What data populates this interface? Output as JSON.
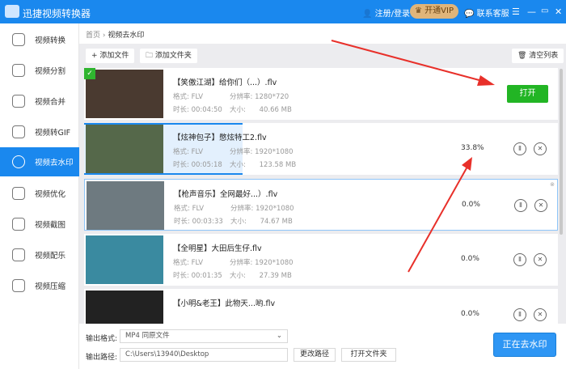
{
  "app": {
    "title": "迅捷视频转换器",
    "login": "注册/登录",
    "vip": "开通VIP",
    "support": "联系客服"
  },
  "sidebar": {
    "items": [
      "视频转换",
      "视频分割",
      "视频合并",
      "视频转GIF",
      "视频去水印",
      "视频优化",
      "视频截图",
      "视频配乐",
      "视频压缩"
    ],
    "active": 4
  },
  "breadcrumb": {
    "home": "首页",
    "sep": "›",
    "current": "视频去水印"
  },
  "toolbar": {
    "add_file": "+ 添加文件",
    "add_folder": "添加文件夹",
    "clear": "清空列表"
  },
  "labels": {
    "format": "格式:",
    "resolution": "分辨率:",
    "duration": "时长:",
    "size": "大小:"
  },
  "files": [
    {
      "name": "【笑傲江湖】给你们（...）.flv",
      "format": "FLV",
      "resolution": "1280*720",
      "duration": "00:04:50",
      "size": "40.66 MB",
      "status": "done",
      "action": "打开"
    },
    {
      "name": "【炫神包子】憋炫特工2.flv",
      "format": "FLV",
      "resolution": "1920*1080",
      "duration": "00:05:18",
      "size": "123.58 MB",
      "progress": "33.8%"
    },
    {
      "name": "【枪声音乐】全网最好...）.flv",
      "format": "FLV",
      "resolution": "1920*1080",
      "duration": "00:03:33",
      "size": "74.67 MB",
      "progress": "0.0%"
    },
    {
      "name": "【全明星】大田后生仔.flv",
      "format": "FLV",
      "resolution": "1920*1080",
      "duration": "00:01:35",
      "size": "27.39 MB",
      "progress": "0.0%"
    },
    {
      "name": "【小明&老王】此物天...哟.flv",
      "progress": "0.0%"
    }
  ],
  "bottom": {
    "format_label": "输出格式:",
    "format_value": "MP4  同原文件",
    "path_label": "输出路径:",
    "path_value": "C:\\Users\\13940\\Desktop",
    "change_path": "更改路径",
    "open_folder": "打开文件夹",
    "start": "正在去水印"
  },
  "colors": {
    "primary": "#1a88ee",
    "open": "#22b524",
    "arrow": "#e8302a"
  }
}
